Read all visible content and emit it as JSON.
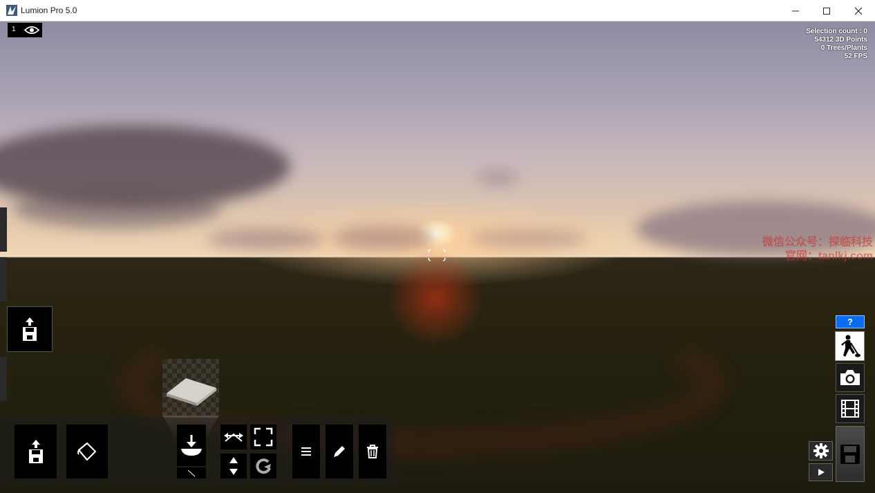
{
  "window": {
    "title": "Lumion Pro 5.0"
  },
  "hud": {
    "layer_number": "1",
    "stats": [
      "Selection count : 0",
      "54312 3D Points",
      "0 Trees/Plants",
      "52 FPS"
    ]
  },
  "watermark": {
    "line1": "微信公众号：探临科技",
    "line2": "官网：tanlkj.com"
  },
  "help": {
    "label": "?"
  },
  "colors": {
    "help_blue": "#0a6cf5",
    "toolbar_bg": "#000000"
  },
  "icons": {
    "load": "floppy-load-icon",
    "paint": "paint-bucket-icon",
    "place": "place-object-icon",
    "move": "move-arrows-icon",
    "scale": "scale-icon",
    "height": "height-arrows-icon",
    "rotate": "rotate-icon",
    "list": "list-icon",
    "edit": "pencil-icon",
    "delete": "trash-icon",
    "build": "builder-icon",
    "photo": "camera-icon",
    "movie": "film-icon",
    "save": "floppy-save-icon",
    "settings": "gear-icon",
    "play": "play-icon"
  }
}
